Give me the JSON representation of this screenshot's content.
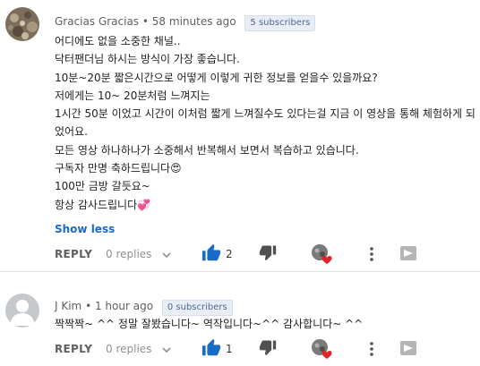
{
  "comments": [
    {
      "author": "Gracias Gracias",
      "time": "58 minutes ago",
      "subscribers": "5 subscribers",
      "lines": [
        "어디에도 없을 소중한 채널..",
        "닥터팬더님 하시는 방식이 가장 좋습니다.",
        "10분~20분 짧은시간으로 어떻게 이렇게 귀한 정보를 얻을수 있을까요?",
        "저에게는 10~ 20분처럼 느껴지는",
        "1시간 50분 이었고 시간이 이처럼 짧게 느껴질수도 있다는걸 지금 이 영상을 통해 체험하게 되",
        "었어요.",
        "모든 영상 하나하나가 소중해서 반복해서 보면서 복습하고 있습니다.",
        "구독자 만명  축하드립니다😍",
        "100만 금방 갈듯요~",
        "항상 감사드립니다💞"
      ],
      "show_less": "Show less",
      "reply_label": "REPLY",
      "replies_label": "0 replies",
      "like_count": "2",
      "avatar_color": "#8a7c6a"
    },
    {
      "author": "J Kim",
      "time": "1 hour ago",
      "subscribers": "0 subscribers",
      "lines": [
        "짝짝짝~ ^^ 정말 잘봤습니다~ 역작입니다~^^ 감사합니다~ ^^"
      ],
      "reply_label": "REPLY",
      "replies_label": "0 replies",
      "like_count": "1",
      "avatar_color": "#c6c9cc"
    }
  ],
  "colors": {
    "like_active": "#1a6bc8",
    "heart": "#e0222a",
    "icon_gray": "#606060"
  },
  "icons": [
    "thumb-up-icon",
    "thumb-down-icon",
    "creator-heart-icon",
    "more-vert-icon",
    "flag-icon",
    "chevron-down-icon"
  ]
}
